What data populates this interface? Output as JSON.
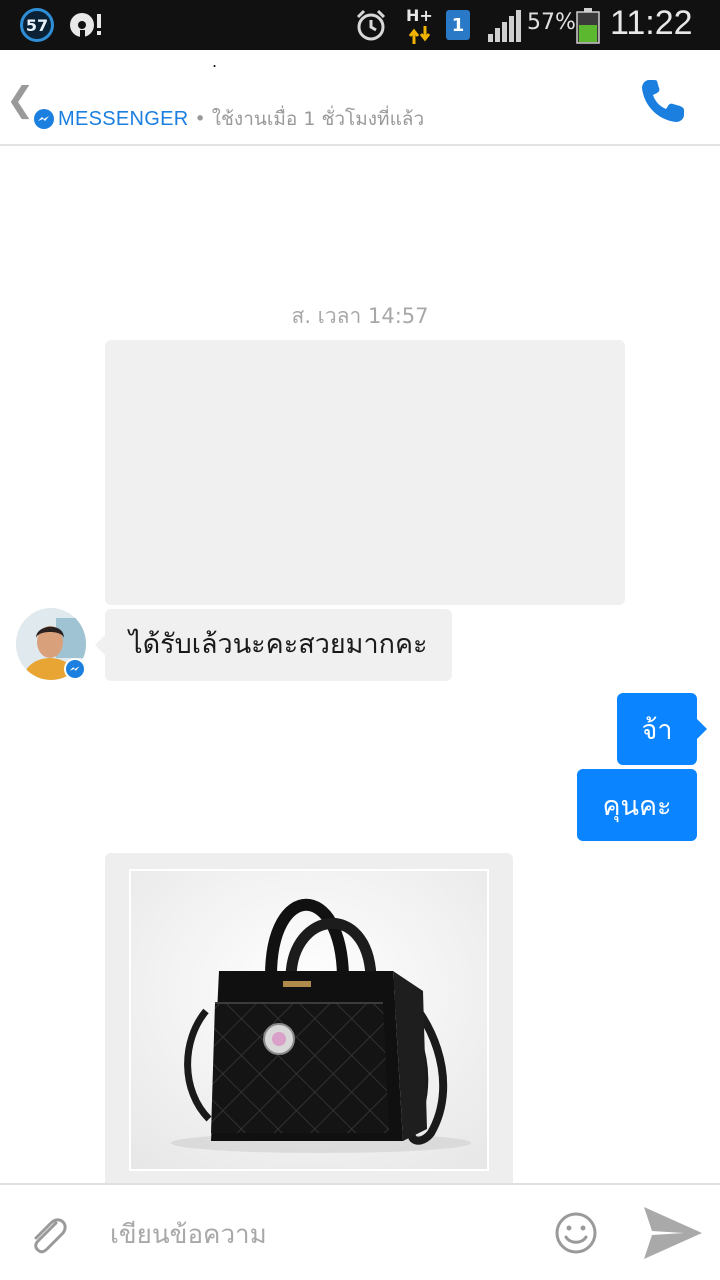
{
  "status_bar": {
    "notification_count": "57",
    "network_type": "H+",
    "sim_slot": "1",
    "battery_percent": "57%",
    "battery_level": 0.57,
    "time": "11:22"
  },
  "header": {
    "title": ".",
    "app_label": "MESSENGER",
    "presence": "• ใช้งานเมื่อ 1 ชั่วโมงที่แล้ว",
    "accent_color": "#1b7fe0"
  },
  "chat": {
    "timestamp": "ส. เวลา 14:57",
    "incoming_message": "ได้รับเล้วนะคะสวยมากคะ",
    "outgoing_messages": [
      "จ้า",
      "คุนคะ"
    ],
    "outgoing_bubble_color": "#0a84ff"
  },
  "icons": {
    "back": "chevron-left-icon",
    "messenger": "messenger-icon",
    "call": "phone-icon",
    "attach": "paperclip-icon",
    "emoji": "smiley-icon",
    "send": "send-icon"
  },
  "composer": {
    "placeholder": "เขียนข้อความ",
    "value": ""
  }
}
